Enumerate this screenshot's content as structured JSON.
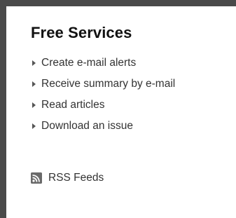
{
  "sidebar": {
    "title": "Free Services",
    "items": [
      {
        "label": "Create e-mail alerts"
      },
      {
        "label": "Receive summary by e-mail"
      },
      {
        "label": "Read articles"
      },
      {
        "label": "Download an issue"
      }
    ],
    "rss": {
      "label": "RSS Feeds",
      "icon": "rss-icon"
    }
  },
  "colors": {
    "border": "#4a4a4a",
    "text": "#333333",
    "title": "#111111"
  }
}
